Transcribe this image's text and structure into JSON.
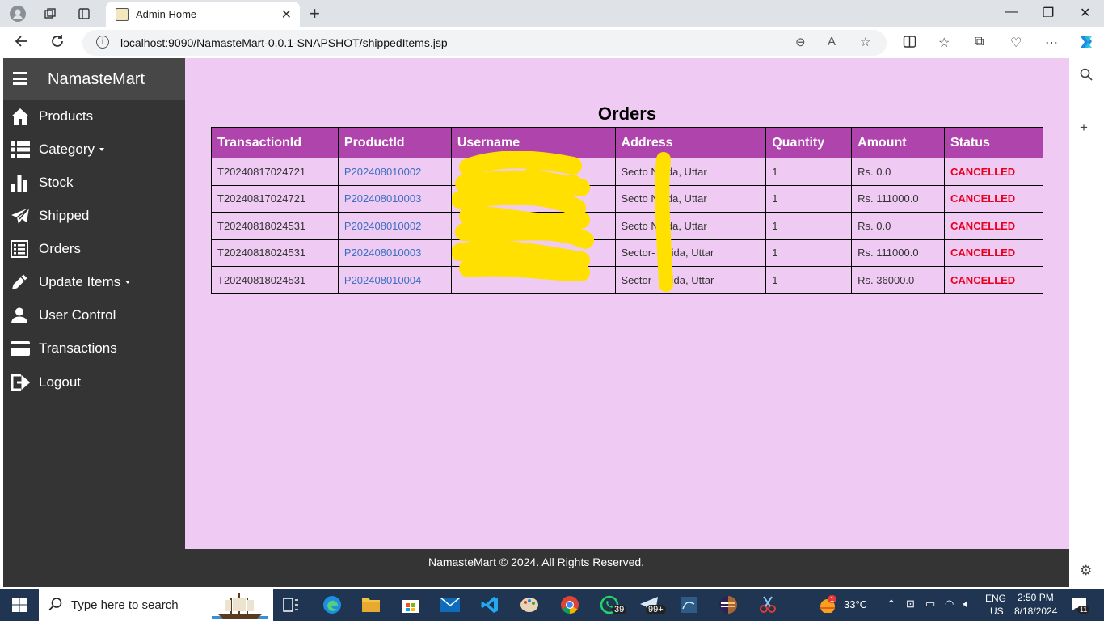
{
  "browser": {
    "tab_title": "Admin Home",
    "tab_close": "✕",
    "new_tab": "+",
    "url": "localhost:9090/NamasteMart-0.0.1-SNAPSHOT/shippedItems.jsp"
  },
  "sidebar": {
    "brand": "NamasteMart",
    "items": [
      {
        "label": "Products",
        "icon": "home-icon"
      },
      {
        "label": "Category",
        "icon": "list-icon",
        "dropdown": true
      },
      {
        "label": "Stock",
        "icon": "bar-chart-icon"
      },
      {
        "label": "Shipped",
        "icon": "send-icon"
      },
      {
        "label": "Orders",
        "icon": "list-alt-icon"
      },
      {
        "label": "Update Items",
        "icon": "pencil-icon",
        "dropdown": true
      },
      {
        "label": "User Control",
        "icon": "user-icon"
      },
      {
        "label": "Transactions",
        "icon": "credit-card-icon"
      },
      {
        "label": "Logout",
        "icon": "logout-icon"
      }
    ]
  },
  "main": {
    "heading": "Orders",
    "columns": [
      "TransactionId",
      "ProductId",
      "Username",
      "Address",
      "Quantity",
      "Amount",
      "Status"
    ],
    "rows": [
      {
        "transaction_id": "T20240817024721",
        "product_id": "P202408010002",
        "username": "",
        "address": "Secto  Noida, Uttar",
        "quantity": "1",
        "amount": "Rs. 0.0",
        "status": "CANCELLED"
      },
      {
        "transaction_id": "T20240817024721",
        "product_id": "P202408010003",
        "username": "",
        "address": "Secto  Noida, Uttar",
        "quantity": "1",
        "amount": "Rs. 111000.0",
        "status": "CANCELLED"
      },
      {
        "transaction_id": "T20240818024531",
        "product_id": "P202408010002",
        "username": "",
        "address": "Secto  Noida, Uttar",
        "quantity": "1",
        "amount": "Rs. 0.0",
        "status": "CANCELLED"
      },
      {
        "transaction_id": "T20240818024531",
        "product_id": "P202408010003",
        "username": "",
        "address": "Sector-  Noida, Uttar",
        "quantity": "1",
        "amount": "Rs. 111000.0",
        "status": "CANCELLED"
      },
      {
        "transaction_id": "T20240818024531",
        "product_id": "P202408010004",
        "username": "",
        "address": "Sector-  Noida, Uttar",
        "quantity": "1",
        "amount": "Rs. 36000.0",
        "status": "CANCELLED"
      }
    ]
  },
  "footer": {
    "text": "NamasteMart © 2024. All Rights Reserved."
  },
  "taskbar": {
    "search_placeholder": "Type here to search",
    "whatsapp_badge": "39",
    "telegram_badge": "99+",
    "temperature": "33°C",
    "weather_badge": "1",
    "language": "ENG",
    "region": "US",
    "time": "2:50 PM",
    "date": "8/18/2024",
    "notifications": "11"
  },
  "colors": {
    "page_bg": "#efcbf3",
    "sidebar_bg": "#343434",
    "table_header_bg": "#b044ad",
    "status_cancelled": "#e8001f",
    "link_blue": "#3b6fc0"
  }
}
